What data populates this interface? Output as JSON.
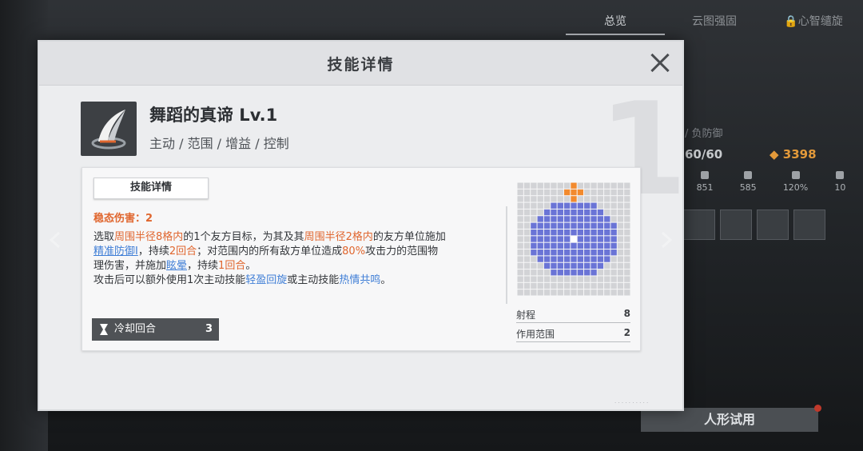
{
  "top_tabs": [
    {
      "label": "总览"
    },
    {
      "label": "云图强固"
    },
    {
      "label": "心智缱旋"
    }
  ],
  "background": {
    "subtitle": "/ 负防御",
    "level": "60/60",
    "gold": "3398",
    "stats": [
      "851",
      "585",
      "120%",
      "10"
    ],
    "trial_button": "人形试用"
  },
  "modal": {
    "title": "技能详情",
    "level_digit": "1",
    "skill": {
      "name": "舞蹈的真谛 Lv.1",
      "tags": "主动 / 范围 / 增益 / 控制"
    },
    "tab_label": "技能详情",
    "steady_damage": "稳态伤害：2",
    "desc": {
      "l1_a": "选取",
      "l1_b": "周围半径8格内",
      "l1_c": "的1个友方目标，为其及其",
      "l1_d": "周围半径2格内",
      "l1_e": "的友方单位施加",
      "l2_a": "精准防御I",
      "l2_b": "，持续",
      "l2_c": "2回合",
      "l2_d": "；对范围内的所有敌方单位造成",
      "l2_e": "80%",
      "l2_f": "攻击力的范围物",
      "l3_a": "理伤害，并施加",
      "l3_b": "眩晕",
      "l3_c": "，持续",
      "l3_d": "1回合",
      "l3_e": "。",
      "l4_a": "攻击后可以额外使用1次主动技能",
      "l4_b": "轻盈回旋",
      "l4_c": "或主动技能",
      "l4_d": "热情共鸣",
      "l4_e": "。"
    },
    "cooldown": {
      "label": "冷却回合",
      "value": "3"
    },
    "range": {
      "label": "射程",
      "value": "8"
    },
    "area": {
      "label": "作用范围",
      "value": "2"
    }
  },
  "colors": {
    "orange": "#e0662e",
    "blue_link": "#3f7ed6",
    "grid_blue": "#6a74d6",
    "grid_orange": "#f28a2e",
    "gold": "#e39a3a"
  },
  "icons": [
    "lock-icon",
    "close-icon",
    "hourglass-icon",
    "chevron-left-icon",
    "chevron-right-icon",
    "skill-blade-icon"
  ]
}
